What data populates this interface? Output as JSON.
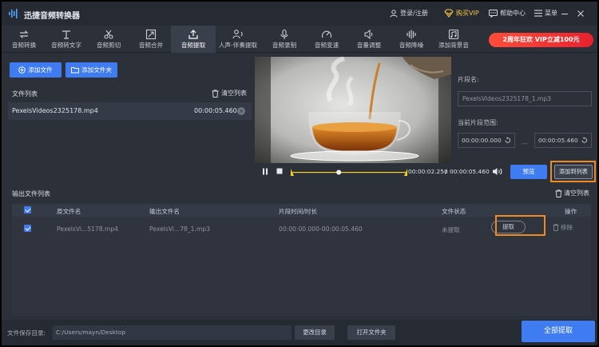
{
  "window": {
    "title": "迅捷音频转换器",
    "login_label": "登录/注册",
    "vip_label": "购买VIP",
    "help_label": "帮助中心",
    "menu_label": "菜单",
    "minimize_icon": "minimize-icon",
    "close_icon": "close-icon"
  },
  "toolbar": {
    "tools": [
      {
        "label": "音频转换",
        "icon": "convert-icon"
      },
      {
        "label": "音频转文字",
        "icon": "text-icon"
      },
      {
        "label": "音频剪切",
        "icon": "scissors-icon"
      },
      {
        "label": "音频合并",
        "icon": "merge-icon"
      },
      {
        "label": "音频提取",
        "icon": "upload-icon",
        "active": true
      },
      {
        "label": "人声-伴奏提取",
        "icon": "voice-icon"
      },
      {
        "label": "音频录制",
        "icon": "mic-icon"
      },
      {
        "label": "音频变速",
        "icon": "speed-icon"
      },
      {
        "label": "音量调整",
        "icon": "volume-icon"
      },
      {
        "label": "音频降噪",
        "icon": "denoise-icon"
      },
      {
        "label": "添加背景音",
        "icon": "background-music-icon"
      }
    ],
    "promo_label": "2周年狂欢 VIP立减100元"
  },
  "left": {
    "add_file_label": "添加文件",
    "add_folder_label": "添加文件夹",
    "file_list_title": "文件列表",
    "clear_list_label": "清空列表",
    "files": [
      {
        "name": "PexelsVideos2325178.mp4",
        "duration": "00:00:05.460"
      }
    ]
  },
  "player": {
    "current_time": "00:00:02.250",
    "separator": "/",
    "total_time": "00:00:05.460",
    "position_fraction": 0.41
  },
  "segment": {
    "name_label": "片段名:",
    "name_value": "PexelsVideos2325178_1.mp3",
    "range_label": "当前片段范围:",
    "start_time": "00:00:00.000",
    "range_dash": "—",
    "end_time": "00:00:05.460",
    "preview_label": "预览",
    "add_to_list_label": "添加到列表"
  },
  "output": {
    "title": "输出文件列表",
    "clear_label": "清空列表",
    "columns": [
      "原文件名",
      "输出文件名",
      "片段时间/时长",
      "文件状态",
      "操作"
    ],
    "rows": [
      {
        "source": "PexelsVi...5178.mp4",
        "output": "PexelsVi...78_1.mp3",
        "segment": "00:00:00.000-00:00:05.460",
        "status": "未提取",
        "extract_label": "提取",
        "remove_label": "移除"
      }
    ]
  },
  "footer": {
    "save_dir_label": "文件保存目录:",
    "save_dir_value": "C:/Users/mayn/Desktop",
    "change_dir_label": "更改目录",
    "open_folder_label": "打开文件夹",
    "extract_all_label": "全部提取"
  },
  "colors": {
    "accent": "#3f7cf2",
    "highlight": "#f08a24",
    "background": "#2b3039",
    "timeline": "#f5d020"
  }
}
